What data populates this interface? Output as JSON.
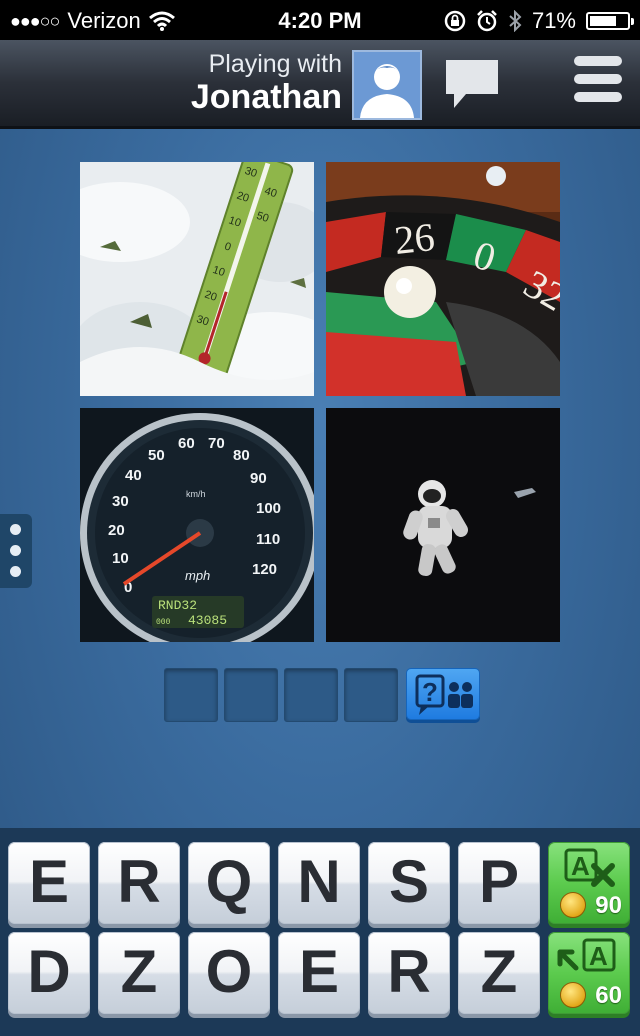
{
  "status_bar": {
    "carrier": "Verizon",
    "time": "4:20 PM",
    "battery": "71%",
    "battery_level": 0.71,
    "icons": [
      "signal-dots-icon",
      "wifi-icon",
      "rotation-lock-icon",
      "alarm-icon",
      "bluetooth-icon",
      "battery-icon"
    ]
  },
  "header": {
    "playing_with_label": "Playing with",
    "opponent_name": "Jonathan",
    "icons": [
      "avatar-icon",
      "chat-icon",
      "menu-icon"
    ]
  },
  "puzzle": {
    "images": [
      {
        "name": "thermometer-in-snow-image",
        "printed_text": [
          "30",
          "20",
          "10",
          "0",
          "10",
          "20",
          "30",
          "40",
          "50"
        ]
      },
      {
        "name": "roulette-wheel-image",
        "printed_text": [
          "26",
          "0",
          "32"
        ]
      },
      {
        "name": "speedometer-image",
        "printed_text": [
          "0",
          "10",
          "20",
          "30",
          "40",
          "50",
          "60",
          "70",
          "80",
          "90",
          "100",
          "110",
          "120",
          "mph",
          "km/h",
          "RND32",
          "43085",
          "000"
        ]
      },
      {
        "name": "astronaut-in-space-image",
        "printed_text": []
      }
    ],
    "answer_slots": 4,
    "hint_button_icon": "ask-friends-icon"
  },
  "keyboard": {
    "row1": [
      "E",
      "R",
      "Q",
      "N",
      "S",
      "P"
    ],
    "row2": [
      "D",
      "Z",
      "O",
      "E",
      "R",
      "Z"
    ],
    "powerups": [
      {
        "name": "remove-letters",
        "icon": "remove-letter-icon",
        "cost": "90"
      },
      {
        "name": "reveal-letter",
        "icon": "reveal-letter-icon",
        "cost": "60"
      }
    ]
  },
  "colors": {
    "background": "#3a6b9e",
    "header": "#2b3039",
    "powerup_green": "#5ccb4e",
    "hint_blue": "#1f7be0"
  }
}
